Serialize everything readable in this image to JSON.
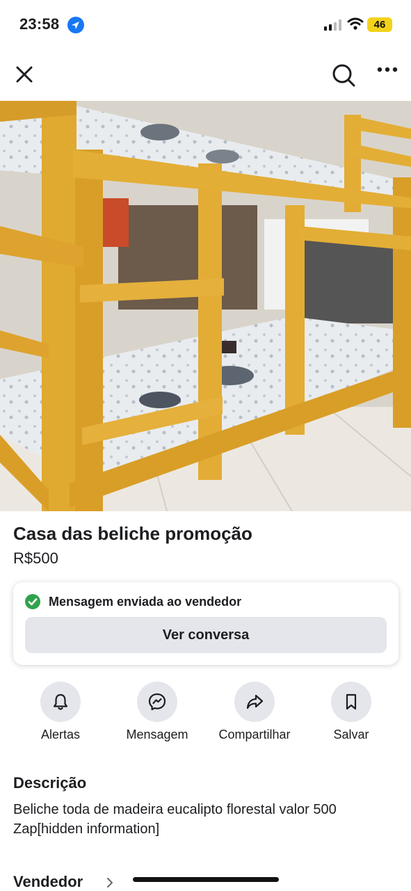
{
  "status_bar": {
    "time": "23:58",
    "battery": "46"
  },
  "listing": {
    "title": "Casa das beliche promoção",
    "price": "R$500"
  },
  "notice": {
    "message": "Mensagem enviada ao vendedor",
    "button_label": "Ver conversa"
  },
  "actions": [
    {
      "label": "Alertas",
      "icon": "bell-icon"
    },
    {
      "label": "Mensagem",
      "icon": "messenger-icon"
    },
    {
      "label": "Compartilhar",
      "icon": "share-icon"
    },
    {
      "label": "Salvar",
      "icon": "bookmark-icon"
    }
  ],
  "description": {
    "heading": "Descrição",
    "text": "Beliche toda de madeira eucalipto florestal valor 500 Zap[hidden information]"
  },
  "seller": {
    "heading": "Vendedor"
  },
  "colors": {
    "accent": "#1877f2",
    "check": "#31a24c",
    "wood": "#e0a930",
    "button_bg": "#e4e6eb"
  }
}
